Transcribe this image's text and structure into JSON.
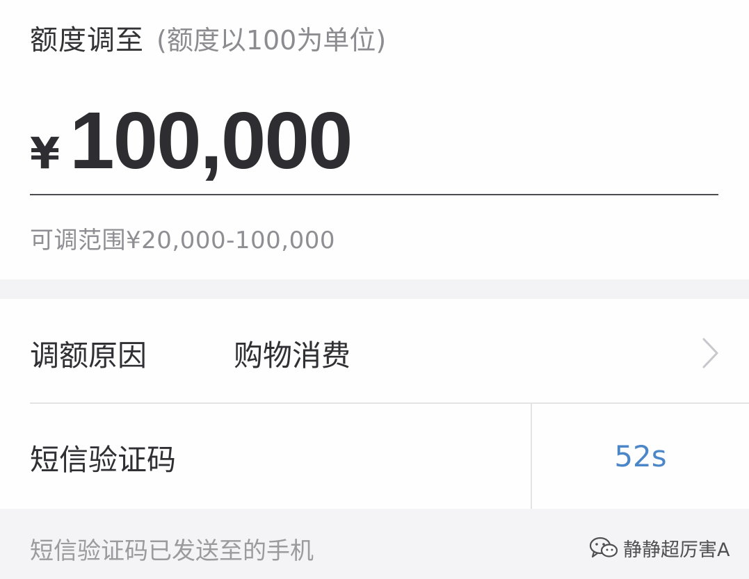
{
  "amount_panel": {
    "title": "额度调至",
    "hint": "(额度以100为单位)",
    "currency_symbol": "¥",
    "amount_value": "100,000",
    "range_text": "可调范围¥20,000-100,000"
  },
  "form": {
    "reason_label": "调额原因",
    "reason_value": "购物消费",
    "sms_code_label": "短信验证码",
    "sms_countdown": "52s"
  },
  "footer": {
    "sms_sent_note": "短信验证码已发送至的手机",
    "watermark_text": "静静超厉害A"
  },
  "icons": {
    "reason_chevron": "chevron-right-icon",
    "watermark_logo": "wechat-icon"
  },
  "colors": {
    "countdown_blue": "#4a86c8",
    "text_dark": "#2f2f33",
    "text_gray": "#8e8e93",
    "divider": "#e3e3e6",
    "background": "#f4f4f6"
  }
}
